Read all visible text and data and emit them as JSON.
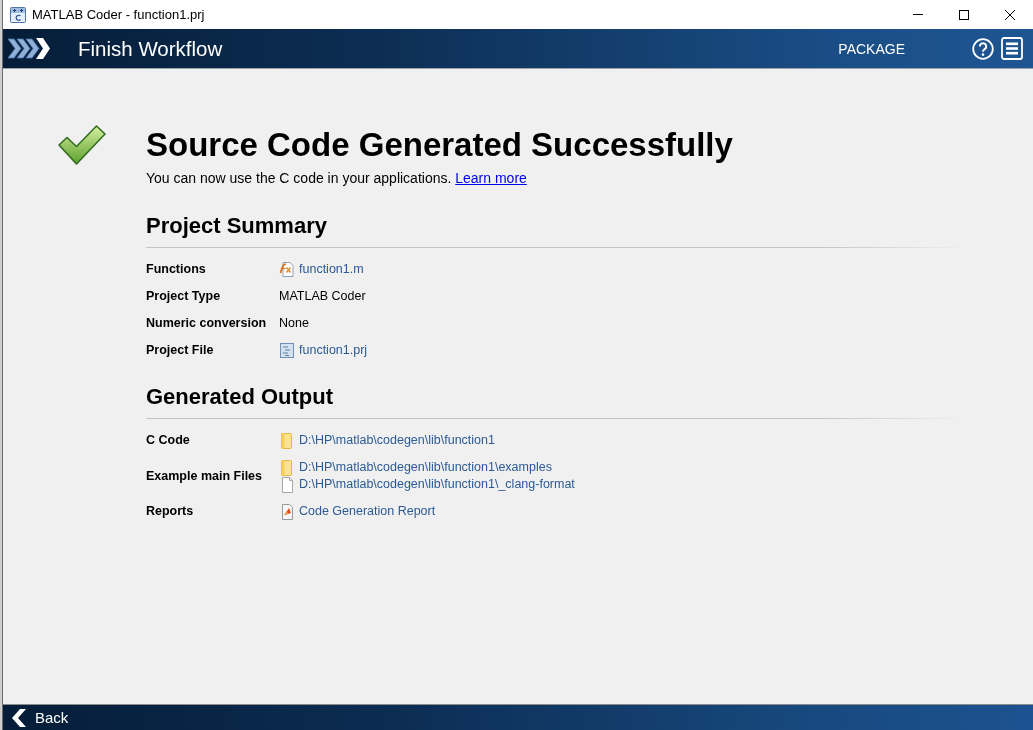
{
  "window": {
    "title": "MATLAB Coder - function1.prj"
  },
  "header": {
    "title": "Finish Workflow",
    "action": "PACKAGE"
  },
  "result": {
    "title": "Source Code Generated Successfully",
    "message": "You can now use the C code in your applications.",
    "link": "Learn more"
  },
  "sections": [
    {
      "title": "Project Summary",
      "rows": [
        {
          "label": "Functions",
          "values": [
            {
              "kind": "function",
              "text": "function1.m"
            }
          ]
        },
        {
          "label": "Project Type",
          "values": [
            {
              "kind": "plain",
              "text": "MATLAB Coder"
            }
          ]
        },
        {
          "label": "Numeric conversion",
          "values": [
            {
              "kind": "plain",
              "text": "None"
            }
          ]
        },
        {
          "label": "Project File",
          "values": [
            {
              "kind": "project",
              "text": "function1.prj"
            }
          ]
        }
      ]
    },
    {
      "title": "Generated Output",
      "rows": [
        {
          "label": "C Code",
          "values": [
            {
              "kind": "folder",
              "text": "D:\\HP\\matlab\\codegen\\lib\\function1"
            }
          ]
        },
        {
          "label": "Example main Files",
          "values": [
            {
              "kind": "folder",
              "text": "D:\\HP\\matlab\\codegen\\lib\\function1\\examples"
            },
            {
              "kind": "file",
              "text": "D:\\HP\\matlab\\codegen\\lib\\function1\\_clang-format"
            }
          ]
        },
        {
          "label": "Reports",
          "values": [
            {
              "kind": "report",
              "text": "Code Generation Report"
            }
          ]
        }
      ]
    }
  ],
  "footer": {
    "back": "Back"
  }
}
